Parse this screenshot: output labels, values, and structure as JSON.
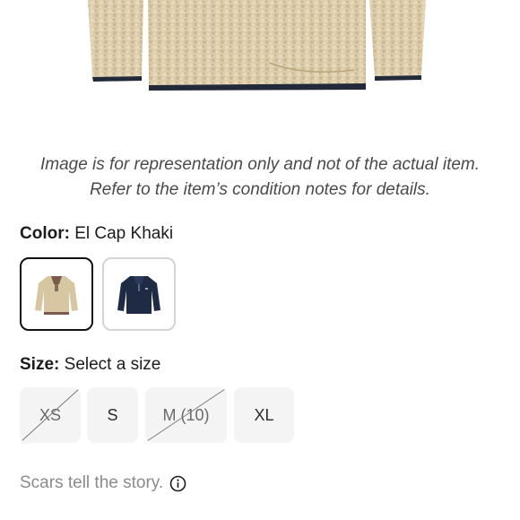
{
  "disclaimer": {
    "line1": "Image is for representation only and not of the actual item.",
    "line2": "Refer to the item’s condition notes for details."
  },
  "color": {
    "label": "Color:",
    "value": "El Cap Khaki",
    "swatches": [
      {
        "icon": "khaki-fleece-pullover",
        "selected": true,
        "color": "#d7c6a2"
      },
      {
        "icon": "navy-fleece-pullover",
        "selected": false,
        "color": "#1f2a44"
      }
    ]
  },
  "size": {
    "label": "Size:",
    "value": "Select a size",
    "options": [
      {
        "label": "XS",
        "available": false
      },
      {
        "label": "S",
        "available": true
      },
      {
        "label": "M (10)",
        "available": false
      },
      {
        "label": "XL",
        "available": true
      }
    ]
  },
  "story": {
    "text": "Scars tell the story.",
    "icon": "info-icon"
  },
  "colors": {
    "fleece": "#dcccaa",
    "trim": "#222a3a",
    "text": "#1b1b1b",
    "muted": "#8b8b8b",
    "chip": "#f4f4f4"
  }
}
